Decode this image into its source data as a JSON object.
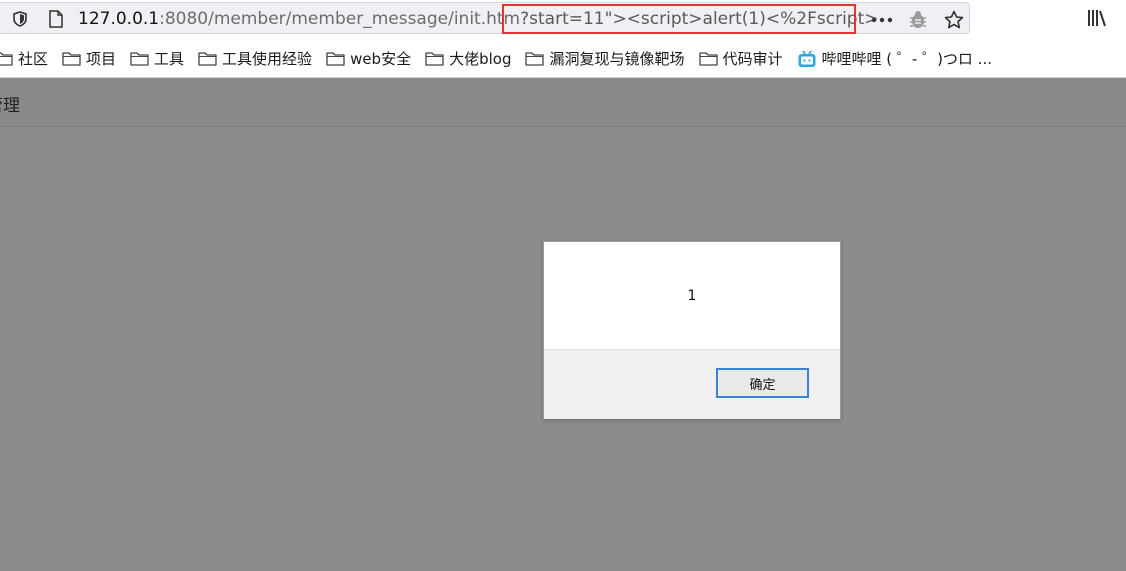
{
  "browser": {
    "url_host": "127.0.0.1",
    "url_path": ":8080/member/member_message/init.htm",
    "url_query": "?start=11\"><script>alert(1)<%2Fscript>",
    "highlight_color": "#e0342e"
  },
  "bookmarks": [
    {
      "label": "社区",
      "icon": "folder-icon"
    },
    {
      "label": "项目",
      "icon": "folder-icon"
    },
    {
      "label": "工具",
      "icon": "folder-icon"
    },
    {
      "label": "工具使用经验",
      "icon": "folder-icon"
    },
    {
      "label": "web安全",
      "icon": "folder-icon"
    },
    {
      "label": "大佬blog",
      "icon": "folder-icon"
    },
    {
      "label": "漏洞复现与镜像靶场",
      "icon": "folder-icon"
    },
    {
      "label": "代码审计",
      "icon": "folder-icon"
    },
    {
      "label": "哔哩哔哩 ( ゜- ゜)つロ ...",
      "icon": "bilibili-icon"
    }
  ],
  "page": {
    "title": "管理"
  },
  "dialog": {
    "message": "1",
    "ok_label": "确定",
    "button_border_color": "#3a83d0"
  }
}
